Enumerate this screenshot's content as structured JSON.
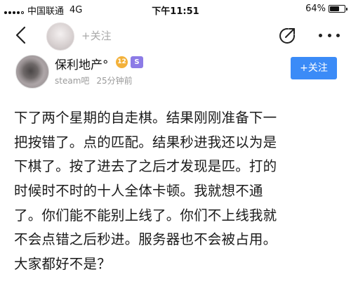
{
  "status_bar": {
    "carrier": "中国联通",
    "network": "4G",
    "time": "下午11:51",
    "battery_percent": "64%",
    "battery_level": 0.64,
    "signal_bars_filled": 4,
    "signal_bars_total": 5
  },
  "nav": {
    "follow_label": "+关注"
  },
  "author": {
    "name": "保利地产°",
    "level": "12",
    "vip_label": "S",
    "forum": "steam吧",
    "time_ago": "25分钟前",
    "follow_button": "+关注"
  },
  "post": {
    "lines": [
      "下了两个星期的自走棋。结果刚刚准备下一",
      "把按错了。点的匹配。结果秒进我还以为是",
      "下棋了。按了进去了之后才发现是匹。打的",
      "时候时不时的十人全体卡顿。我就想不通",
      "了。你们能不能别上线了。你们不上线我就",
      "不会点错之后秒进。服务器也不会被占用。",
      "大家都好不是？"
    ]
  },
  "colors": {
    "accent": "#3b8bf7",
    "level_badge": "#f3b13a",
    "vip_badge": "#8c7be6",
    "muted_text": "#9a9a9a"
  },
  "icons": {
    "back": "chevron-left-icon",
    "share": "share-icon",
    "more": "more-icon"
  }
}
